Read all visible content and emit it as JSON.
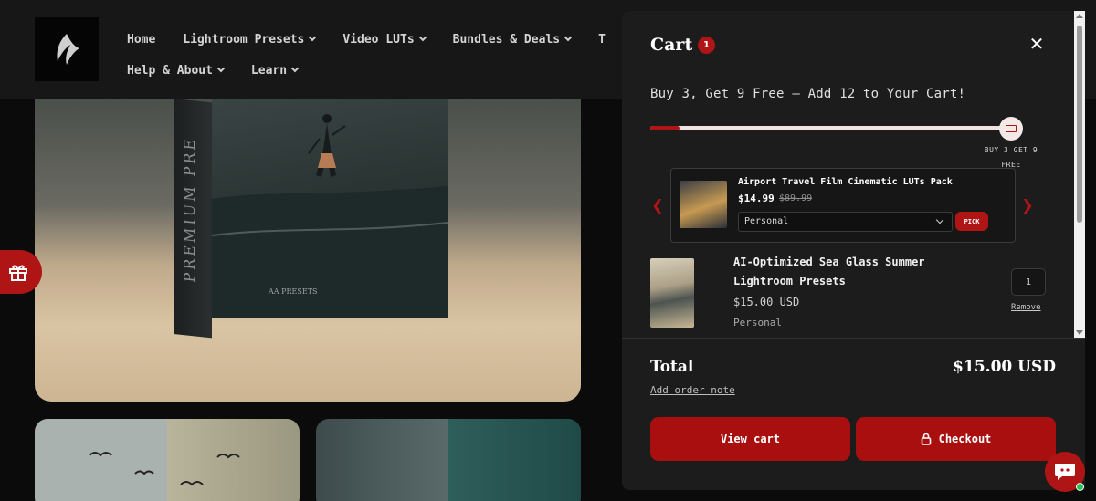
{
  "nav": {
    "row1": [
      {
        "label": "Home",
        "has_dropdown": false
      },
      {
        "label": "Lightroom Presets",
        "has_dropdown": true
      },
      {
        "label": "Video LUTs",
        "has_dropdown": true
      },
      {
        "label": "Bundles & Deals",
        "has_dropdown": true
      },
      {
        "label": "T",
        "has_dropdown": false
      }
    ],
    "row2": [
      {
        "label": "Help & About",
        "has_dropdown": true
      },
      {
        "label": "Learn",
        "has_dropdown": true
      }
    ]
  },
  "hero": {
    "box_label": "PREMIUM PRE",
    "box_brand": "AA PRESETS"
  },
  "cart": {
    "title": "Cart",
    "count": "1",
    "promo": "Buy 3, Get 9 Free – Add 12 to Your Cart!",
    "progress_fraction": 0.08,
    "progress_caption": "BUY 3 GET 9 FREE",
    "upsell": {
      "title": "Airport Travel Film Cinematic LUTs Pack",
      "price": "$14.99",
      "compare_price": "$89.99",
      "variant": "Personal",
      "pick_label": "PICK"
    },
    "item": {
      "title": "AI-Optimized Sea Glass Summer Lightroom Presets",
      "price": "$15.00 USD",
      "variant": "Personal",
      "quantity": "1",
      "remove_label": "Remove"
    },
    "total_label": "Total",
    "total_value": "$15.00 USD",
    "note_label": "Add order note",
    "view_cart_label": "View cart",
    "checkout_label": "Checkout"
  },
  "colors": {
    "accent": "#b01515",
    "drawer_bg": "#1c1c1c",
    "header_bg": "#171717"
  }
}
